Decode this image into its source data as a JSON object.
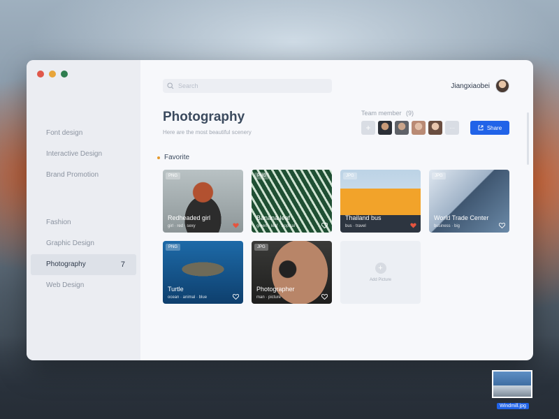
{
  "colors": {
    "accent": "#2163e8",
    "favorite_dot": "#e59a2e",
    "heart_active": "#e5543f",
    "heart_inactive": "#ffffff"
  },
  "sidebar": {
    "groups": [
      [
        "Font design",
        "Interactive Design",
        "Brand Promotion"
      ],
      [
        "Fashion",
        "Graphic Design",
        "Photography",
        "Web Design"
      ]
    ],
    "items": [
      {
        "label": "Font design"
      },
      {
        "label": "Interactive Design"
      },
      {
        "label": "Brand Promotion"
      },
      {
        "label": "Fashion"
      },
      {
        "label": "Graphic Design"
      },
      {
        "label": "Photography",
        "count": "7",
        "active": true
      },
      {
        "label": "Web Design"
      }
    ]
  },
  "search": {
    "placeholder": "Search",
    "icon": "search-icon"
  },
  "user": {
    "name": "Jiangxiaobei"
  },
  "header": {
    "title": "Photography",
    "subtitle": "Here are the most beautiful scenery"
  },
  "team": {
    "label": "Team member",
    "count": "(9)",
    "add_label": "+",
    "more_label": "···",
    "members": [
      "member-1",
      "member-2",
      "member-3",
      "member-4"
    ]
  },
  "share": {
    "label": "Share",
    "icon": "share-icon"
  },
  "section": {
    "label": "Favorite"
  },
  "cards": [
    {
      "badge": "PNG",
      "title": "Redheaded girl",
      "tags": "girl · red · sexy",
      "liked": true
    },
    {
      "badge": "PNG",
      "title": "Banana leaf",
      "tags": "green · leaf · tropical",
      "liked": false
    },
    {
      "badge": "JPG",
      "title": "Thailand bus",
      "tags": "bus · travel",
      "liked": true
    },
    {
      "badge": "JPG",
      "title": "World Trade Center",
      "tags": "business · big",
      "liked": false
    },
    {
      "badge": "PNG",
      "title": "Turtle",
      "tags": "ocean · animal · blue",
      "liked": false
    },
    {
      "badge": "JPG",
      "title": "Photographer",
      "tags": "man · picture",
      "liked": false
    }
  ],
  "add_picture": {
    "label": "Add Picture",
    "icon_label": "+"
  },
  "desktop_file": {
    "label": "Windmill.jpg"
  }
}
